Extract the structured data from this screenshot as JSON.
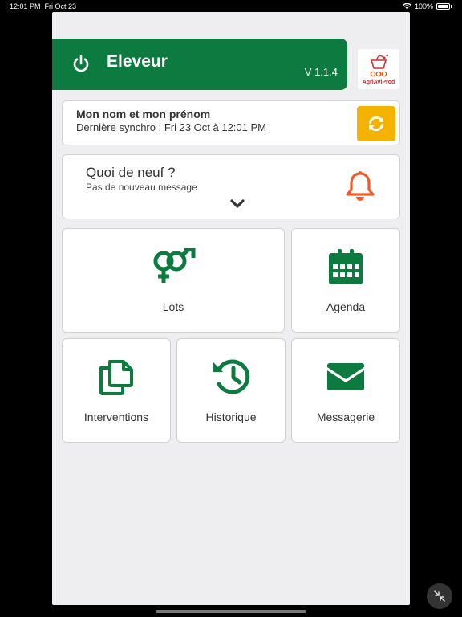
{
  "status_bar": {
    "time": "12:01 PM",
    "date": "Fri Oct 23",
    "battery": "100%"
  },
  "header": {
    "title": "Eleveur",
    "version": "V 1.1.4",
    "logo_text": "AgriAviProd"
  },
  "user": {
    "name": "Mon nom et mon prénom",
    "sync": "Dernière synchro : Fri 23 Oct à 12:01 PM"
  },
  "news": {
    "title": "Quoi de neuf ?",
    "subtitle": "Pas de nouveau message"
  },
  "tiles": {
    "lots": "Lots",
    "agenda": "Agenda",
    "interventions": "Interventions",
    "historique": "Historique",
    "messagerie": "Messagerie"
  },
  "colors": {
    "green": "#0d7b3f",
    "sync_yellow": "#f5b301",
    "bell_orange": "#f05a28"
  }
}
